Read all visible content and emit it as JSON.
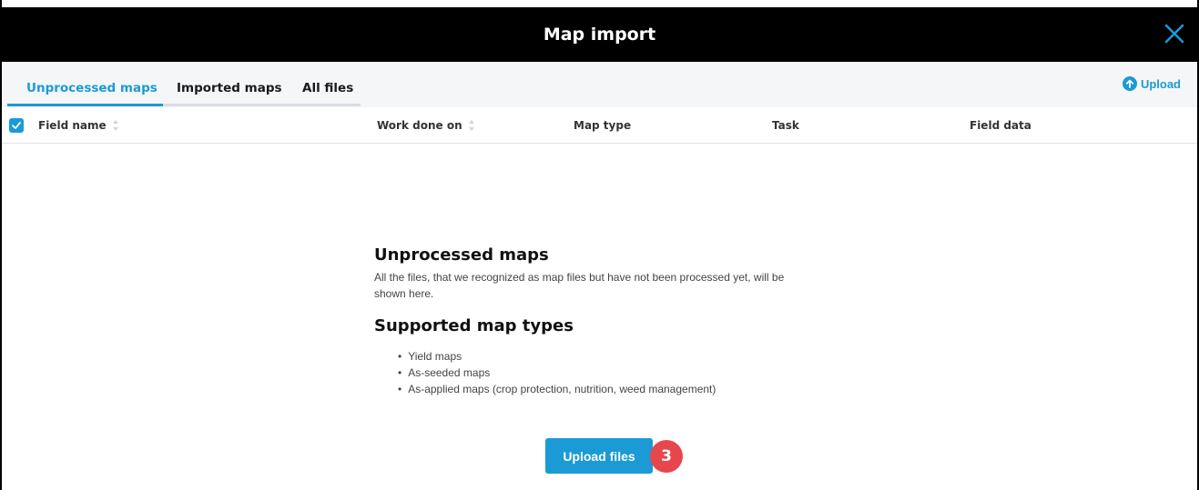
{
  "dialog": {
    "title": "Map import",
    "close_icon": "close-icon"
  },
  "tabs": [
    {
      "label": "Unprocessed maps",
      "active": true
    },
    {
      "label": "Imported maps",
      "active": false
    },
    {
      "label": "All files",
      "active": false
    }
  ],
  "toolbar": {
    "upload_label": "Upload",
    "upload_icon": "upload-circle-icon"
  },
  "table": {
    "select_all_checked": true,
    "columns": [
      "Field name",
      "Work done on",
      "Map type",
      "Task",
      "Field data"
    ]
  },
  "empty_state": {
    "heading": "Unprocessed maps",
    "description": "All the files, that we recognized as map files but have not been processed yet, will be shown here.",
    "supported_heading": "Supported map types",
    "supported_types": [
      "Yield maps",
      "As-seeded maps",
      "As-applied maps (crop protection, nutrition, weed management)"
    ],
    "upload_button_label": "Upload files"
  },
  "annotation": {
    "step_number": "3"
  },
  "colors": {
    "accent": "#1b9ad6",
    "titlebar": "#000000",
    "badge": "#e6474c"
  }
}
